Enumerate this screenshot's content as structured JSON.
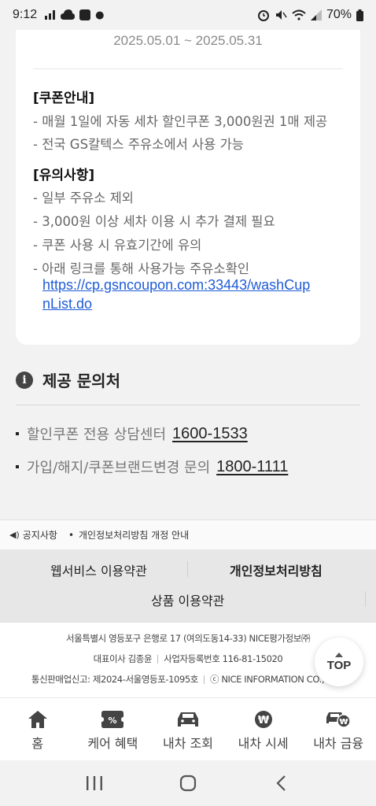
{
  "status_bar": {
    "time": "9:12",
    "battery": "70%"
  },
  "coupon_card": {
    "period": "2025.05.01 ~ 2025.05.31",
    "info_title": "[쿠폰안내]",
    "info_lines": [
      "- 매월 1일에 자동 세차 할인쿠폰 3,000원권 1매 제공",
      "- 전국 GS칼텍스 주유소에서 사용 가능"
    ],
    "caution_title": "[유의사항]",
    "caution_lines": [
      "- 일부 주유소 제외",
      "- 3,000원 이상 세차 이용 시 추가 결제 필요",
      "- 쿠폰 사용 시 유효기간에 유의",
      "- 아래 링크를 통해 사용가능 주유소확인"
    ],
    "link_line1": "https://cp.gsncoupon.com:33443/washCup",
    "link_line2": "nList.do"
  },
  "contact": {
    "title": "제공 문의처",
    "rows": [
      {
        "label": "할인쿠폰 전용 상담센터",
        "number": "1600-1533"
      },
      {
        "label": "가입/해지/쿠폰브랜드변경 문의",
        "number": "1800-1111"
      }
    ]
  },
  "notice": {
    "label": "공지사항",
    "item": "개인정보처리방침 개정 안내"
  },
  "terms": {
    "web_service": "웹서비스 이용약관",
    "privacy": "개인정보처리방침",
    "product": "상품 이용약관"
  },
  "footer": {
    "address": "서울특별시 영등포구 은행로 17 (여의도동14-33) NICE평가정보㈜",
    "ceo": "대표이사 김종윤",
    "biz_no": "사업자등록번호 116-81-15020",
    "mail_order": "통신판매업신고: 제2024-서울영등포-1095호",
    "copyright": "ⓒ NICE INFORMATION CO., LTD."
  },
  "top_button": "TOP",
  "tabs": [
    {
      "label": "홈",
      "icon": "home-icon"
    },
    {
      "label": "케어 혜택",
      "icon": "coupon-icon"
    },
    {
      "label": "내차 조회",
      "icon": "car-icon"
    },
    {
      "label": "내차 시세",
      "icon": "won-coin-icon"
    },
    {
      "label": "내차 금융",
      "icon": "car-loan-icon"
    }
  ],
  "colors": {
    "link": "#1f5bd6",
    "text_muted": "#666666",
    "terms_bg": "#e7e7e7"
  }
}
